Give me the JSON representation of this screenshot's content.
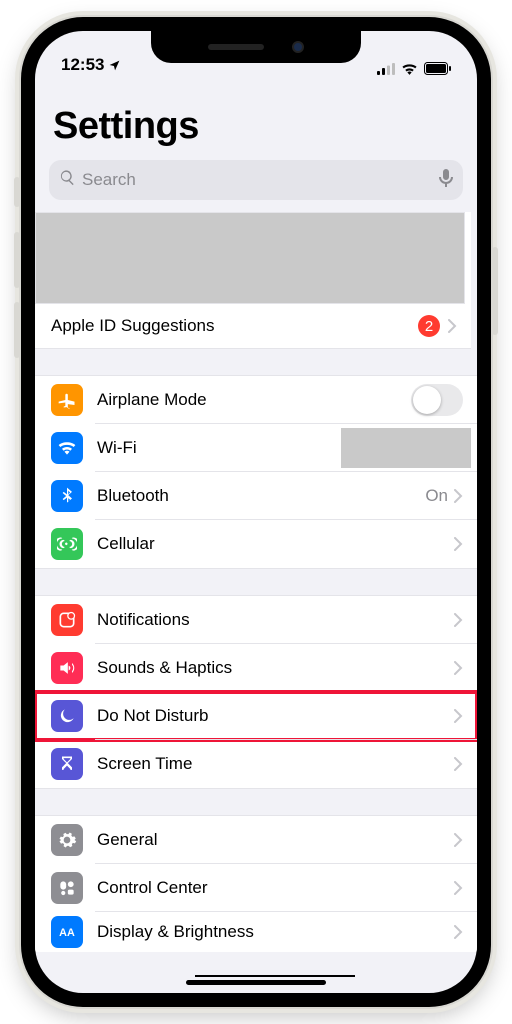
{
  "status": {
    "time": "12:53"
  },
  "header": {
    "title": "Settings"
  },
  "search": {
    "placeholder": "Search"
  },
  "apple_id": {
    "suggestions_label": "Apple ID Suggestions",
    "badge": "2"
  },
  "group_connectivity": {
    "airplane": {
      "label": "Airplane Mode",
      "icon_bg": "#ff9500"
    },
    "wifi": {
      "label": "Wi-Fi",
      "icon_bg": "#007aff"
    },
    "bluetooth": {
      "label": "Bluetooth",
      "value": "On",
      "icon_bg": "#007aff"
    },
    "cellular": {
      "label": "Cellular",
      "icon_bg": "#34c759"
    }
  },
  "group_focus": {
    "notifications": {
      "label": "Notifications",
      "icon_bg": "#ff3b30"
    },
    "sounds": {
      "label": "Sounds & Haptics",
      "icon_bg": "#ff2d55"
    },
    "dnd": {
      "label": "Do Not Disturb",
      "icon_bg": "#5856d6"
    },
    "screentime": {
      "label": "Screen Time",
      "icon_bg": "#5856d6"
    }
  },
  "group_general": {
    "general": {
      "label": "General",
      "icon_bg": "#8e8e93"
    },
    "controlcenter": {
      "label": "Control Center",
      "icon_bg": "#8e8e93"
    },
    "display": {
      "label": "Display & Brightness",
      "icon_bg": "#007aff"
    }
  }
}
